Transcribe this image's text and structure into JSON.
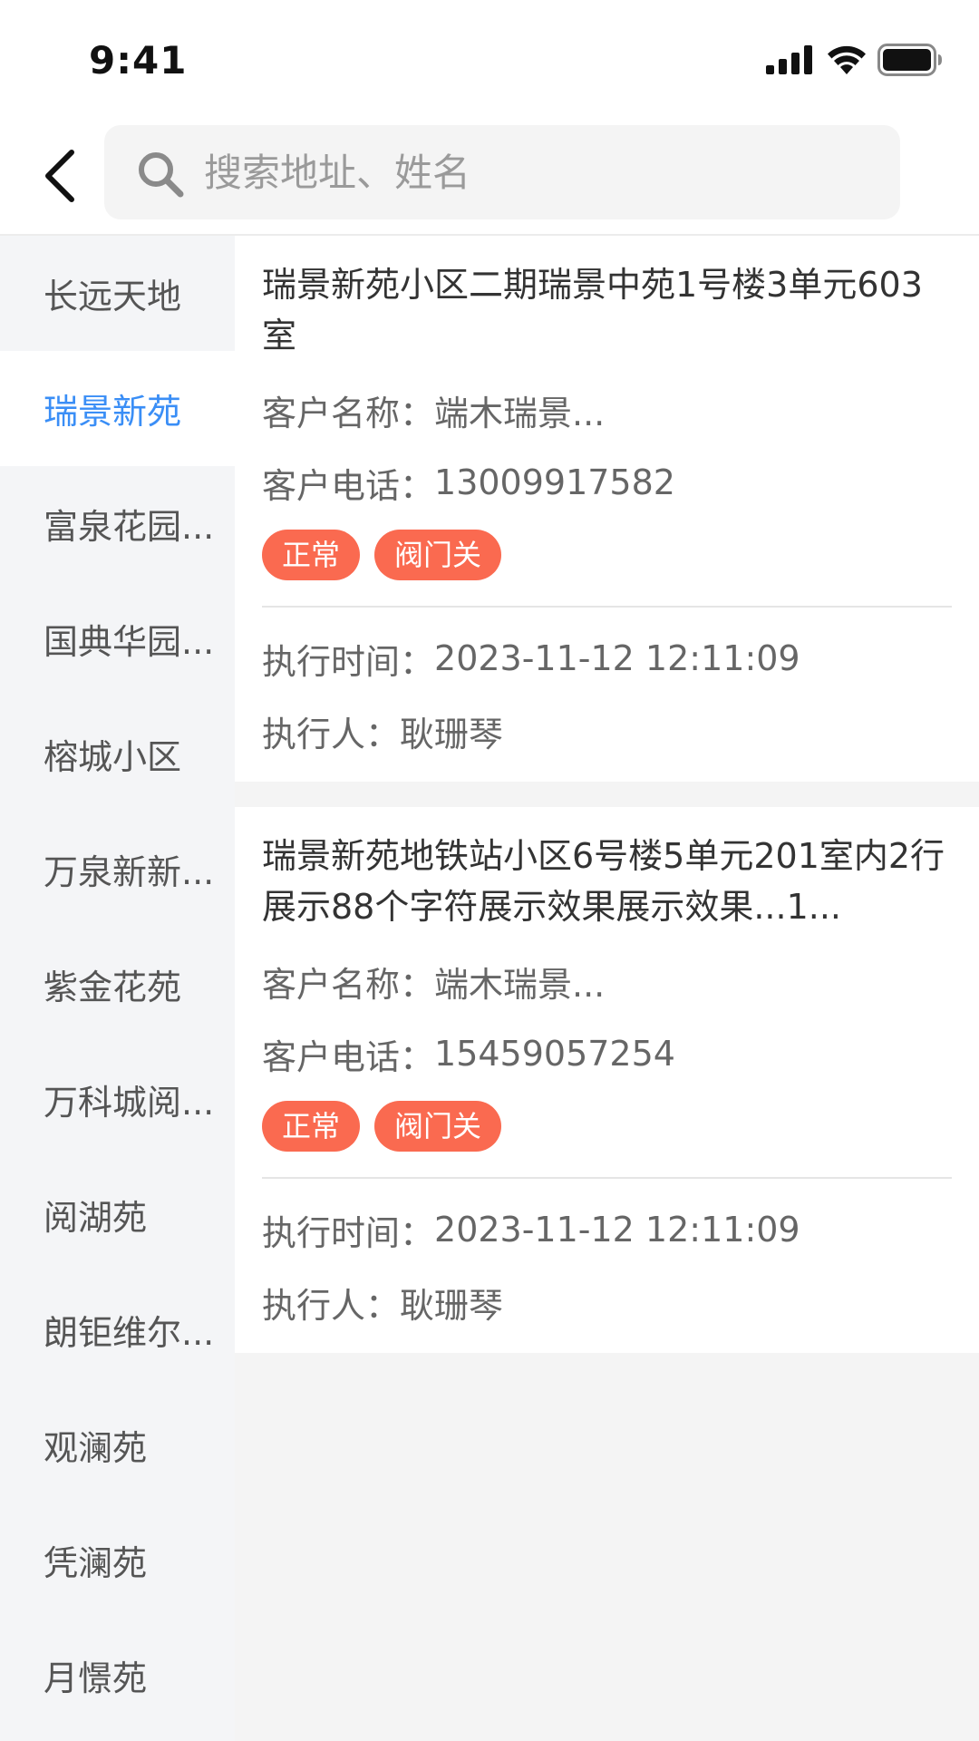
{
  "status_bar": {
    "time": "9:41"
  },
  "header": {
    "search_placeholder": "搜索地址、姓名"
  },
  "sidebar": {
    "items": [
      {
        "label": "长远天地"
      },
      {
        "label": "瑞景新苑"
      },
      {
        "label": "富泉花园..."
      },
      {
        "label": "国典华园..."
      },
      {
        "label": "榕城小区"
      },
      {
        "label": "万泉新新..."
      },
      {
        "label": "紫金花苑"
      },
      {
        "label": "万科城阅..."
      },
      {
        "label": "阅湖苑"
      },
      {
        "label": "朗钜维尔..."
      },
      {
        "label": "观澜苑"
      },
      {
        "label": "凭澜苑"
      },
      {
        "label": "月憬苑"
      }
    ],
    "active_index": 1
  },
  "labels": {
    "customer_name": "客户名称：",
    "customer_phone": "客户电话：",
    "exec_time": "执行时间：",
    "executor": "执行人："
  },
  "cards": [
    {
      "address": "瑞景新苑小区二期瑞景中苑1号楼3单元603室",
      "customer_name": "端木瑞景...",
      "customer_phone": "13009917582",
      "tags": [
        "正常",
        "阀门关"
      ],
      "exec_time": "2023-11-12 12:11:09",
      "executor": "耿珊琴"
    },
    {
      "address": "瑞景新苑地铁站小区6号楼5单元201室内2行展示88个字符展示效果展示效果...1...",
      "customer_name": "端木瑞景...",
      "customer_phone": "15459057254",
      "tags": [
        "正常",
        "阀门关"
      ],
      "exec_time": "2023-11-12 12:11:09",
      "executor": "耿珊琴"
    }
  ],
  "colors": {
    "accent": "#3a8ef6",
    "tag": "#fa6a50"
  }
}
